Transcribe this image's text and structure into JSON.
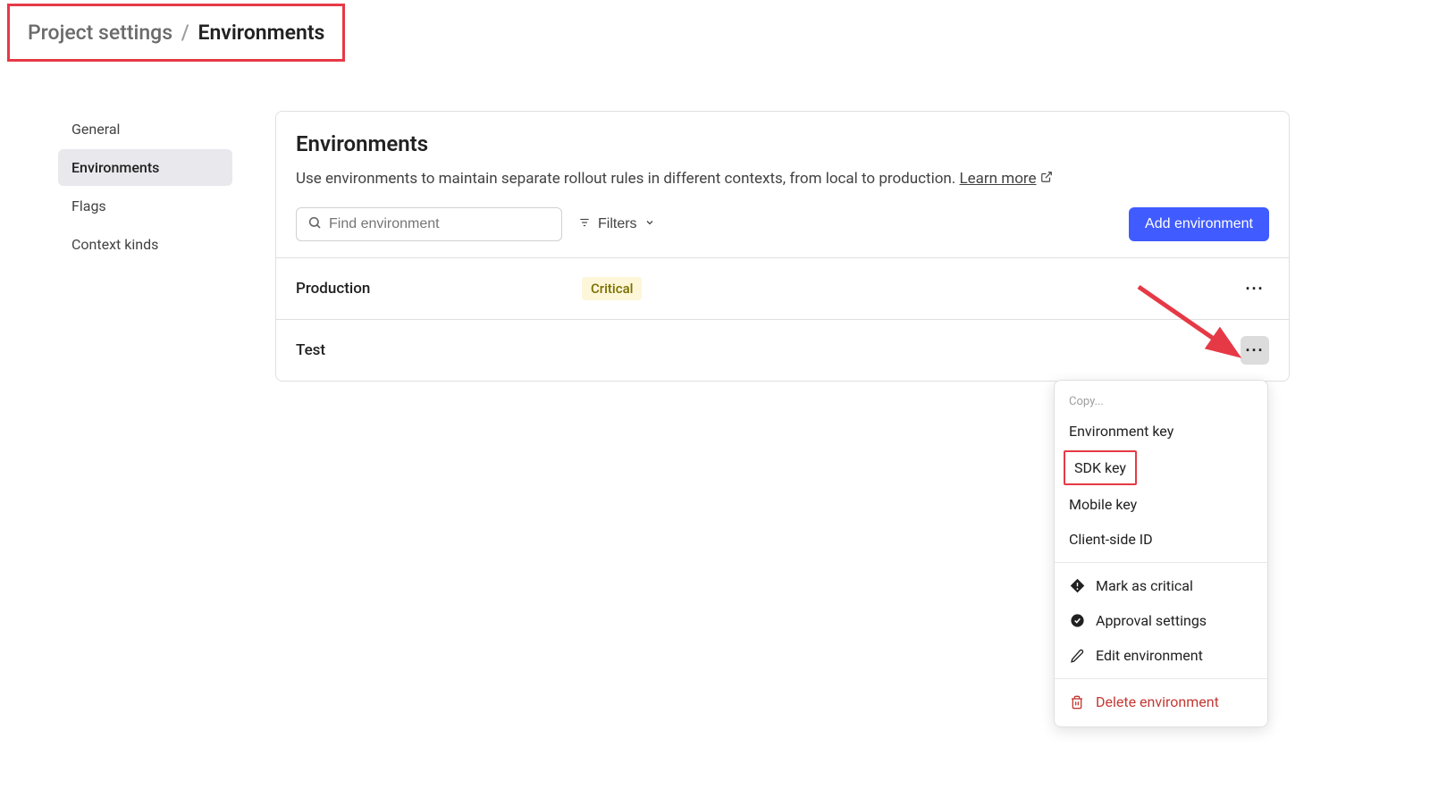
{
  "breadcrumb": {
    "parent": "Project settings",
    "separator": "/",
    "current": "Environments"
  },
  "sidebar": {
    "items": [
      {
        "label": "General",
        "active": false
      },
      {
        "label": "Environments",
        "active": true
      },
      {
        "label": "Flags",
        "active": false
      },
      {
        "label": "Context kinds",
        "active": false
      }
    ]
  },
  "panel": {
    "title": "Environments",
    "description": "Use environments to maintain separate rollout rules in different contexts, from local to production. ",
    "learn_more": "Learn more"
  },
  "toolbar": {
    "search_placeholder": "Find environment",
    "filters_label": "Filters",
    "add_label": "Add environment"
  },
  "environments": [
    {
      "name": "Production",
      "badge": "Critical"
    },
    {
      "name": "Test",
      "badge": null
    }
  ],
  "dropdown": {
    "section_label": "Copy...",
    "copy_items": [
      "Environment key",
      "SDK key",
      "Mobile key",
      "Client-side ID"
    ],
    "action_items": [
      {
        "label": "Mark as critical",
        "icon": "diamond-exclaim"
      },
      {
        "label": "Approval settings",
        "icon": "check-badge"
      },
      {
        "label": "Edit environment",
        "icon": "pencil"
      }
    ],
    "danger_item": {
      "label": "Delete environment",
      "icon": "trash"
    }
  }
}
